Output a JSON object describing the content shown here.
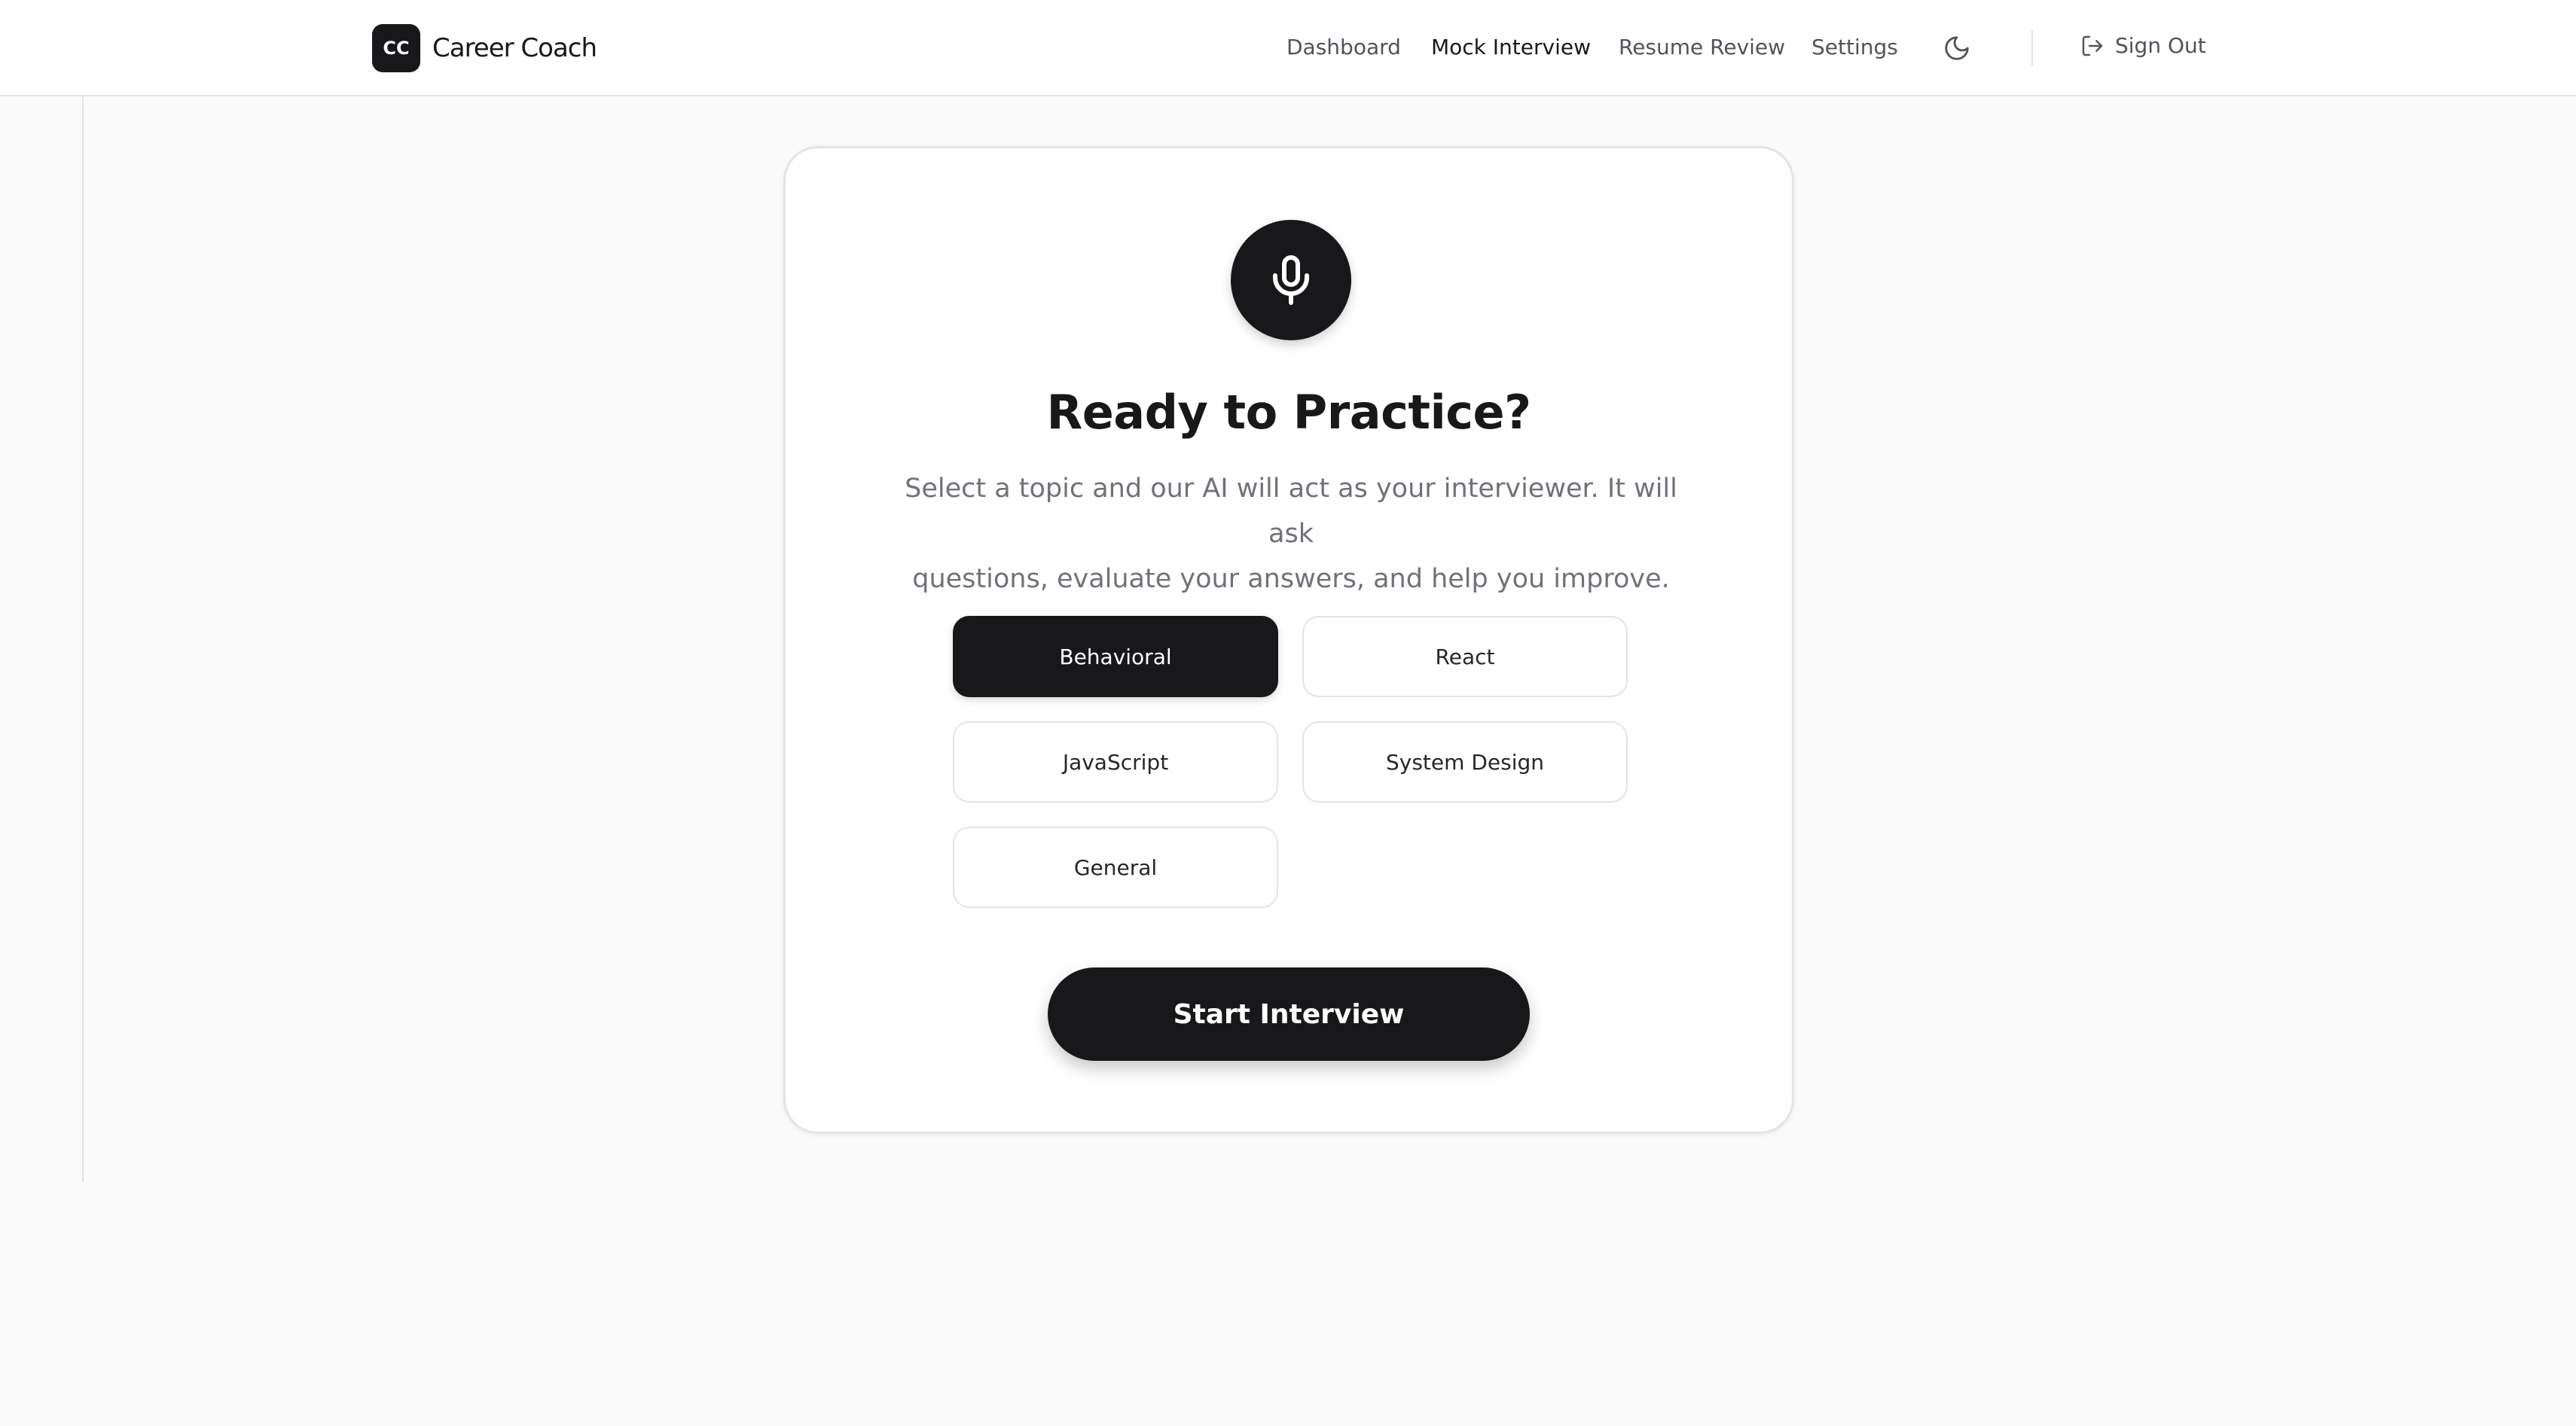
{
  "app": {
    "logo_text": "CC",
    "name": "Career Coach"
  },
  "nav": {
    "items": [
      {
        "label": "Dashboard",
        "active": false
      },
      {
        "label": "Mock Interview",
        "active": true
      },
      {
        "label": "Resume Review",
        "active": false
      },
      {
        "label": "Settings",
        "active": false
      }
    ],
    "theme_toggle_icon": "moon-icon",
    "sign_out_label": "Sign Out",
    "sign_out_icon": "log-out-icon"
  },
  "main": {
    "hero_icon": "microphone-icon",
    "title": "Ready to Practice?",
    "description_line1": "Select a topic and our AI will act as your interviewer. It will ask",
    "description_line2": "questions, evaluate your answers, and help you improve.",
    "topics": [
      {
        "label": "Behavioral",
        "selected": true
      },
      {
        "label": "React",
        "selected": false
      },
      {
        "label": "JavaScript",
        "selected": false
      },
      {
        "label": "System Design",
        "selected": false
      },
      {
        "label": "General",
        "selected": false
      }
    ],
    "start_label": "Start Interview"
  },
  "colors": {
    "primary": "#18181b",
    "muted_text": "#71717a",
    "border": "#e4e4e7",
    "background": "#fafafa"
  }
}
